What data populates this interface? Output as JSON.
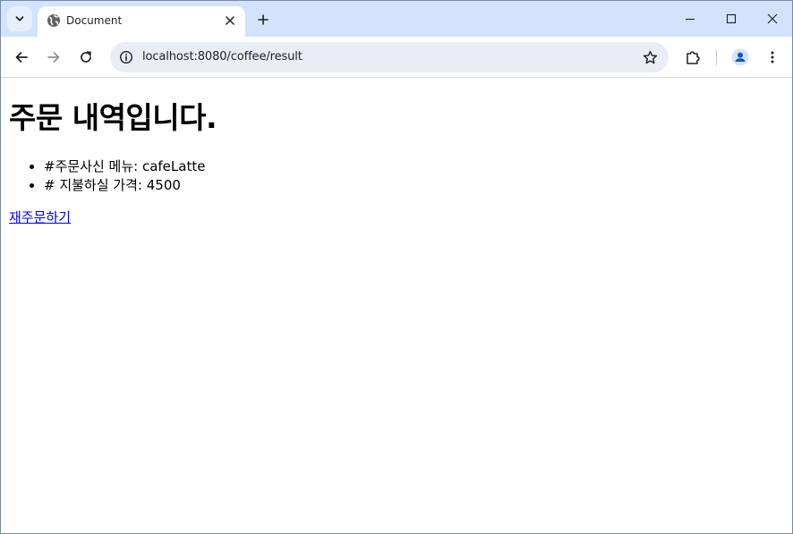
{
  "browser": {
    "tab": {
      "title": "Document",
      "favicon": "globe-icon"
    },
    "address": "localhost:8080/coffee/result",
    "icons": {
      "tab_search": "chevron-down-icon",
      "tab_close": "close-icon",
      "new_tab": "plus-icon",
      "minimize": "minimize-icon",
      "maximize": "maximize-icon",
      "close_window": "close-icon",
      "back": "back-arrow-icon",
      "forward": "forward-arrow-icon",
      "reload": "reload-icon",
      "site_info": "info-icon",
      "bookmark": "star-icon",
      "extensions": "puzzle-icon",
      "profile": "profile-icon",
      "menu": "more-vert-icon"
    },
    "colors": {
      "tabstrip": "#d3e3fd",
      "omnibox": "#e9eef6",
      "link": "#0000ee",
      "profile_accent": "#0b57d0"
    }
  },
  "page": {
    "heading": "주문 내역입니다.",
    "items": [
      "#주문사신 메뉴: cafeLatte",
      "# 지불하실 가격: 4500"
    ],
    "reorder_link": "재주문하기"
  }
}
